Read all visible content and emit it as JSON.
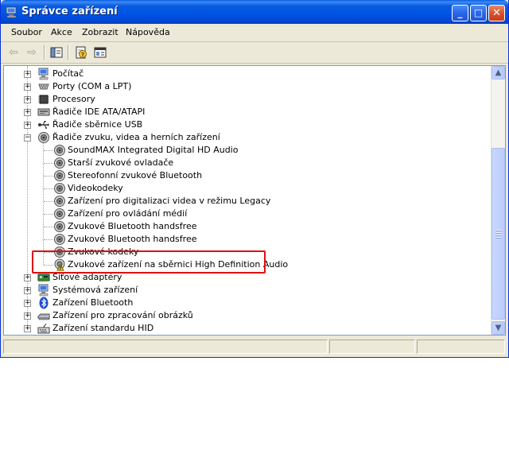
{
  "window": {
    "title": "Správce zařízení",
    "controls": {
      "minimize": "_",
      "maximize": "□",
      "close": "✕"
    }
  },
  "menu": [
    {
      "label": "Soubor"
    },
    {
      "label": "Akce"
    },
    {
      "label": "Zobrazit"
    },
    {
      "label": "Nápověda"
    }
  ],
  "toolbar": {
    "back_icon": "arrow-left-icon",
    "forward_icon": "arrow-right-icon",
    "back_glyph": "⇦",
    "forward_glyph": "⇨"
  },
  "tree": {
    "top_items": [
      {
        "label": "Počítač",
        "icon": "computer-icon"
      },
      {
        "label": "Porty (COM a LPT)",
        "icon": "port-icon"
      },
      {
        "label": "Procesory",
        "icon": "processor-icon"
      },
      {
        "label": "Řadiče IDE ATA/ATAPI",
        "icon": "ide-controller-icon"
      },
      {
        "label": "Řadiče sběrnice USB",
        "icon": "usb-icon"
      },
      {
        "label": "Řadiče zvuku, videa a herních zařízení",
        "icon": "sound-icon",
        "expanded": true
      }
    ],
    "sound_children": [
      {
        "label": "SoundMAX Integrated Digital HD Audio"
      },
      {
        "label": "Starší zvukové ovladače"
      },
      {
        "label": "Stereofonní zvukové Bluetooth"
      },
      {
        "label": "Videokodeky"
      },
      {
        "label": "Zařízení pro digitalizaci videa v režimu Legacy"
      },
      {
        "label": "Zařízení pro ovládání médií"
      },
      {
        "label": "Zvukové Bluetooth handsfree"
      },
      {
        "label": "Zvukové Bluetooth handsfree"
      },
      {
        "label": "Zvukové kodeky"
      },
      {
        "label": "Zvukové zařízení na sběrnici High Definition Audio",
        "warning": true
      }
    ],
    "bottom_items": [
      {
        "label": "Síťové adaptéry",
        "icon": "network-adapter-icon"
      },
      {
        "label": "Systémová zařízení",
        "icon": "system-device-icon"
      },
      {
        "label": "Zařízení Bluetooth",
        "icon": "bluetooth-icon"
      },
      {
        "label": "Zařízení pro zpracování obrázků",
        "icon": "scanner-icon"
      },
      {
        "label": "Zařízení standardu HID",
        "icon": "hid-icon"
      }
    ],
    "expander_collapsed": "+",
    "expander_expanded": "−"
  },
  "scrollbar": {
    "up": "▲",
    "down": "▼"
  },
  "colors": {
    "title_blue": "#0055e5",
    "highlight_red": "#e01010",
    "face": "#ece9d8"
  }
}
